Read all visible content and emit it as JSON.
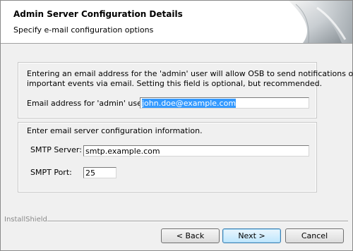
{
  "header": {
    "title": "Admin Server Configuration Details",
    "subtitle": "Specify e-mail configuration options"
  },
  "admin_panel": {
    "description_line1": "Entering an email address for the 'admin' user will allow OSB to send notifications of",
    "description_line2": "important events via email. Setting this field is optional, but recommended.",
    "email_label": "Email address for 'admin' user:",
    "email_value": "john.doe@example.com"
  },
  "smtp_panel": {
    "description": "Enter email server configuration information.",
    "server_label": "SMTP Server:",
    "server_value": "smtp.example.com",
    "port_label": "SMPT Port:",
    "port_value": "25"
  },
  "footer": {
    "brand": "InstallShield",
    "back_label": "< Back",
    "next_label": "Next >",
    "cancel_label": "Cancel"
  },
  "colors": {
    "selection": "#3399ff",
    "default_button_border": "#3c7fb1"
  }
}
